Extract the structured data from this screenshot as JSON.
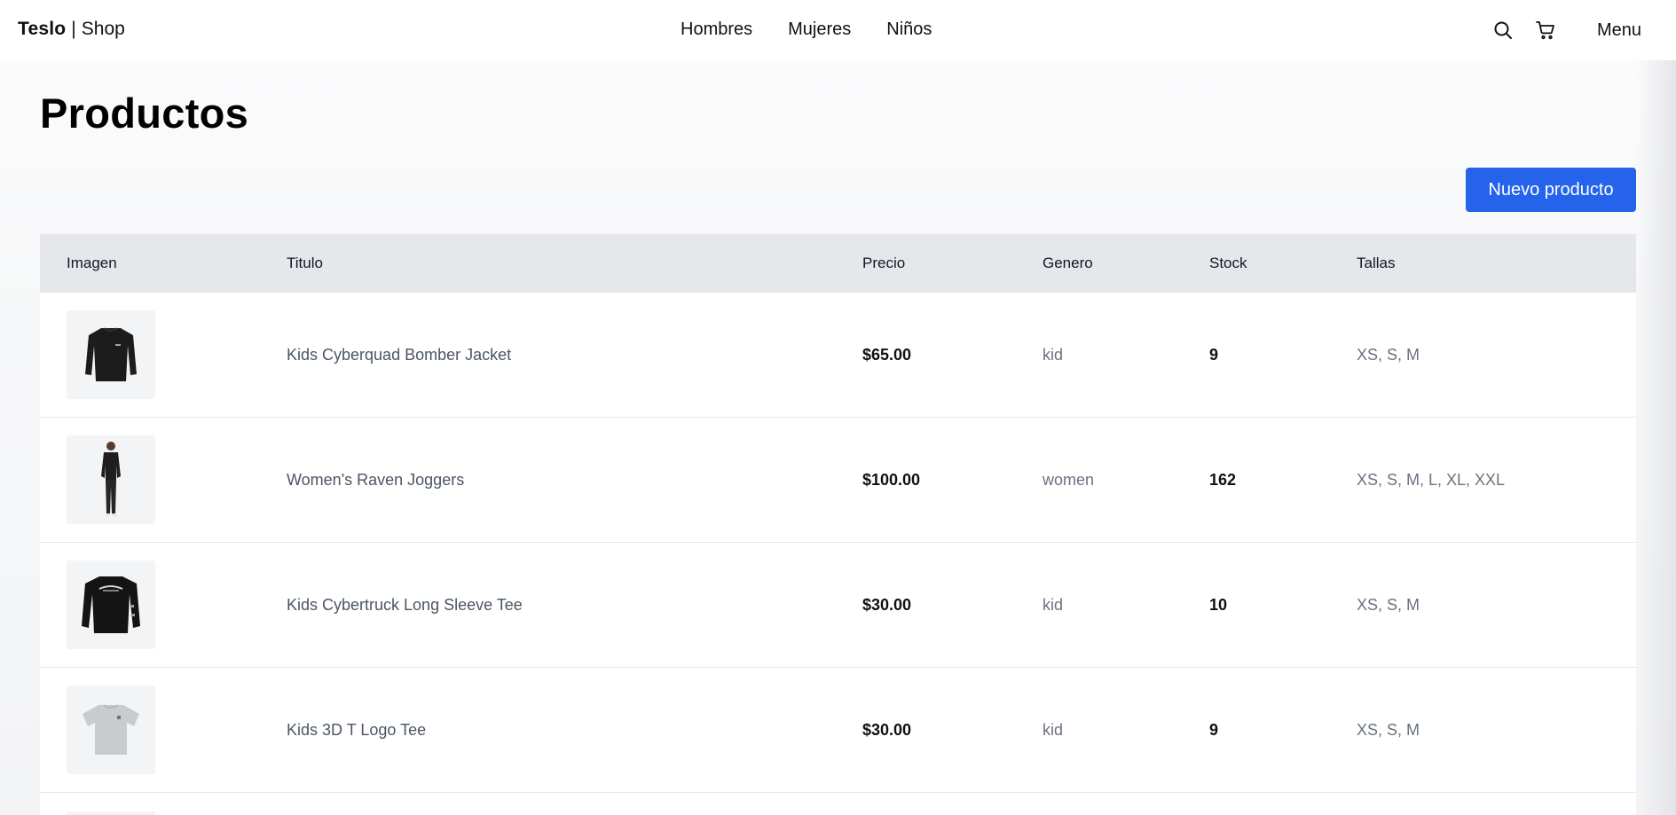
{
  "header": {
    "brand_bold": "Teslo",
    "brand_sep": "|",
    "brand_light": "Shop",
    "nav": [
      "Hombres",
      "Mujeres",
      "Niños"
    ],
    "menu_label": "Menu",
    "icons": [
      "search-icon",
      "cart-icon"
    ]
  },
  "page": {
    "title": "Productos",
    "new_button_label": "Nuevo producto"
  },
  "colors": {
    "accent": "#2563eb",
    "table_header_bg": "#e5e7eb"
  },
  "table": {
    "columns": [
      "Imagen",
      "Titulo",
      "Precio",
      "Genero",
      "Stock",
      "Tallas"
    ],
    "rows": [
      {
        "image": "black-long-sleeve-jacket",
        "title": "Kids Cyberquad Bomber Jacket",
        "price": "$65.00",
        "gender": "kid",
        "stock": "9",
        "sizes": "XS, S, M"
      },
      {
        "image": "woman-in-black-joggers",
        "title": "Women's Raven Joggers",
        "price": "$100.00",
        "gender": "women",
        "stock": "162",
        "sizes": "XS, S, M, L, XL, XXL"
      },
      {
        "image": "black-long-sleeve-tee",
        "title": "Kids Cybertruck Long Sleeve Tee",
        "price": "$30.00",
        "gender": "kid",
        "stock": "10",
        "sizes": "XS, S, M"
      },
      {
        "image": "grey-t-shirt",
        "title": "Kids 3D T Logo Tee",
        "price": "$30.00",
        "gender": "kid",
        "stock": "9",
        "sizes": "XS, S, M"
      }
    ]
  }
}
